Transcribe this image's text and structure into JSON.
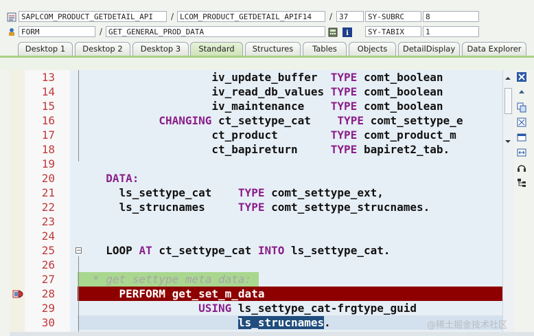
{
  "debugger": {
    "program": "SAPLCOM_PRODUCT_GETDETAIL_API",
    "include": "LCOM_PRODUCT_GETDETAIL_APIF14",
    "line": "37",
    "sysvar1_name": "SY-SUBRC",
    "sysvar1_value": "8",
    "event_type": "FORM",
    "event_name": "GET_GENERAL_PROD_DATA",
    "sysvar2_name": "SY-TABIX",
    "sysvar2_value": "1",
    "separator": "/"
  },
  "tabs": [
    {
      "label": "Desktop 1"
    },
    {
      "label": "Desktop 2"
    },
    {
      "label": "Desktop 3"
    },
    {
      "label": "Standard"
    },
    {
      "label": "Structures"
    },
    {
      "label": "Tables"
    },
    {
      "label": "Objects"
    },
    {
      "label": "DetailDisplay"
    },
    {
      "label": "Data Explorer"
    }
  ],
  "active_tab": "Standard",
  "code_lines": [
    {
      "no": "13",
      "parts": [
        {
          "t": "                  "
        },
        {
          "t": "iv_update_buffer  "
        },
        {
          "t": "TYPE",
          "kw": true
        },
        {
          "t": " comt_boolean"
        }
      ]
    },
    {
      "no": "14",
      "parts": [
        {
          "t": "                  "
        },
        {
          "t": "iv_read_db_values "
        },
        {
          "t": "TYPE",
          "kw": true
        },
        {
          "t": " comt_boolean"
        }
      ]
    },
    {
      "no": "15",
      "parts": [
        {
          "t": "                  "
        },
        {
          "t": "iv_maintenance    "
        },
        {
          "t": "TYPE",
          "kw": true
        },
        {
          "t": " comt_boolean"
        }
      ]
    },
    {
      "no": "16",
      "parts": [
        {
          "t": "          "
        },
        {
          "t": "CHANGING",
          "kw": true
        },
        {
          "t": " ct_settype_cat    "
        },
        {
          "t": "TYPE",
          "kw": true
        },
        {
          "t": " comt_settype_e"
        }
      ]
    },
    {
      "no": "17",
      "parts": [
        {
          "t": "                  "
        },
        {
          "t": "ct_product        "
        },
        {
          "t": "TYPE",
          "kw": true
        },
        {
          "t": " comt_product_m"
        }
      ]
    },
    {
      "no": "18",
      "parts": [
        {
          "t": "                  "
        },
        {
          "t": "ct_bapireturn     "
        },
        {
          "t": "TYPE",
          "kw": true
        },
        {
          "t": " bapiret2_tab."
        }
      ]
    },
    {
      "no": "19",
      "parts": []
    },
    {
      "no": "20",
      "parts": [
        {
          "t": "  "
        },
        {
          "t": "DATA:",
          "kw": true
        }
      ]
    },
    {
      "no": "21",
      "parts": [
        {
          "t": "    ls_settype_cat    "
        },
        {
          "t": "TYPE",
          "kw": true
        },
        {
          "t": " comt_settype_ext,"
        }
      ]
    },
    {
      "no": "22",
      "parts": [
        {
          "t": "    ls_strucnames     "
        },
        {
          "t": "TYPE",
          "kw": true
        },
        {
          "t": " comt_settype_strucnames."
        }
      ]
    },
    {
      "no": "23",
      "parts": []
    },
    {
      "no": "24",
      "parts": []
    },
    {
      "no": "25",
      "parts": [
        {
          "t": "  LOOP "
        },
        {
          "t": "AT",
          "kw": true
        },
        {
          "t": " ct_settype_cat "
        },
        {
          "t": "INTO",
          "kw": true
        },
        {
          "t": " ls_settype_cat."
        }
      ]
    },
    {
      "no": "26",
      "parts": []
    },
    {
      "no": "27",
      "parts": [
        {
          "t": "* get settype meta data:",
          "cm": true
        }
      ]
    },
    {
      "no": "28",
      "parts": [
        {
          "t": "    PERFORM get_set_m_data"
        }
      ]
    },
    {
      "no": "29",
      "parts": [
        {
          "t": "                "
        },
        {
          "t": "USING",
          "kw": true
        },
        {
          "t": " ls_settype_cat-frgtype_guid"
        }
      ]
    },
    {
      "no": "30",
      "parts": [
        {
          "t": "                      "
        },
        {
          "t": "ls_strucnames",
          "sel": true
        },
        {
          "t": "."
        }
      ]
    }
  ],
  "watermark": "@稀土掘金技术社区",
  "colors": {
    "line_number": "#c0383c",
    "keyword": "#8a1e8a",
    "current_line": "#8e0000",
    "comment_bg": "#a9d78f",
    "tab_active": "#cfe3b8"
  },
  "icons": {
    "program": "program-icon",
    "form": "form-icon",
    "right_tools": [
      "close-icon",
      "scroll-up-icon",
      "copy-icon",
      "fullscreen-icon",
      "window-icon",
      "width-icon",
      "headset-icon",
      "tree-icon"
    ]
  }
}
